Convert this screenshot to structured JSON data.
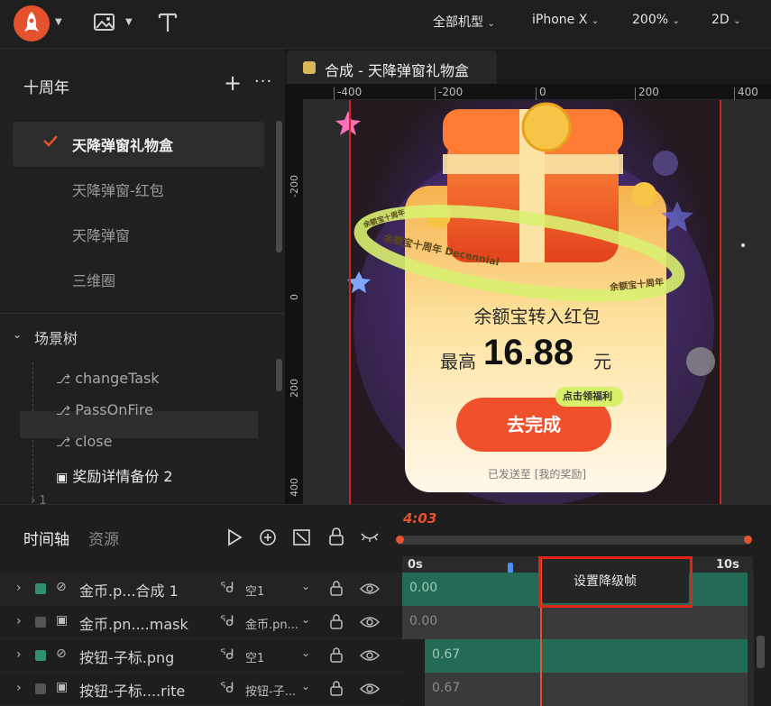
{
  "toolbar": {
    "devices_filter": "全部机型",
    "device": "iPhone X",
    "zoom": "200%",
    "mode": "2D"
  },
  "sidebar": {
    "project_title": "十周年",
    "compositions": [
      {
        "label": "天降弹窗礼物盒",
        "selected": true
      },
      {
        "label": "天降弹窗-红包"
      },
      {
        "label": "天降弹窗"
      },
      {
        "label": "三维圈"
      }
    ],
    "scene_tree_title": "场景树",
    "scene_items": [
      "changeTask",
      "PassOnFire",
      "close",
      "奖励详情备份 2"
    ],
    "scene_partial": "1"
  },
  "tab": {
    "label": "合成 - 天降弹窗礼物盒"
  },
  "ruler": {
    "h_ticks": [
      "-400",
      "-200",
      "0",
      "200",
      "400"
    ],
    "v_ticks": [
      "-200",
      "0",
      "200",
      "400"
    ]
  },
  "canvas": {
    "ring_text_left": "余额宝十周年 Decennial",
    "ring_text_right": "余额宝十周年",
    "ring_text_small": "余额宝十周年",
    "card_title": "余额宝转入红包",
    "prefix": "最高",
    "amount": "16.88",
    "unit": "元",
    "badge": "点击领福利",
    "cta": "去完成",
    "footer": "已发送至 [我的奖励]"
  },
  "timeline": {
    "tabs": [
      "时间轴",
      "资源"
    ],
    "current_time": "4:03",
    "start_label": "0s",
    "end_label": "10s",
    "popup_label": "设置降级帧",
    "layers": [
      {
        "name": "金币.p...合成 1",
        "source": "空1",
        "color": "#2f8f6f",
        "track_value": "0.00"
      },
      {
        "name": "金币.pn....mask",
        "source": "金币.pn...",
        "color": "#555555",
        "track_value": "0.00"
      },
      {
        "name": "按钮-子标.png",
        "source": "空1",
        "color": "#2f8f6f",
        "track_value": "0.67"
      },
      {
        "name": "按钮-子标....rite",
        "source": "按钮-子...",
        "color": "#555555",
        "track_value": "0.67"
      }
    ]
  },
  "colors": {
    "accent_red": "#e4532d",
    "guide_red": "#c8281e",
    "track_green": "#236b57",
    "track_gray": "#3a3a3a"
  }
}
